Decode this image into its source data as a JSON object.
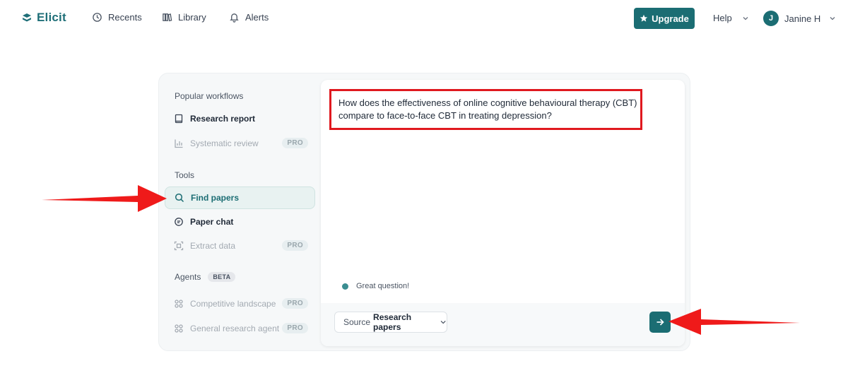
{
  "nav": {
    "brand": "Elicit",
    "recents": "Recents",
    "library": "Library",
    "alerts": "Alerts",
    "upgrade": "Upgrade",
    "help": "Help",
    "user_name": "Janine H",
    "user_initial": "J"
  },
  "sidebar": {
    "popular_title": "Popular workflows",
    "tools_title": "Tools",
    "agents_title": "Agents",
    "agents_badge": "BETA",
    "items": [
      {
        "label": "Research report",
        "icon": "book-icon"
      },
      {
        "label": "Systematic review",
        "icon": "chart-icon",
        "badge": "PRO"
      },
      {
        "label": "Find papers",
        "icon": "search-icon",
        "active": true
      },
      {
        "label": "Paper chat",
        "icon": "chat-icon"
      },
      {
        "label": "Extract data",
        "icon": "extract-icon",
        "badge": "PRO"
      },
      {
        "label": "Competitive landscape",
        "icon": "agent-icon",
        "badge": "PRO"
      },
      {
        "label": "General research agent",
        "icon": "agent-icon",
        "badge": "PRO"
      }
    ]
  },
  "query": {
    "text": "How does the effectiveness of online cognitive behavioural therapy (CBT) compare to face-to-face CBT in treating depression?",
    "status": "Great question!",
    "source_label": "Source",
    "source_value": "Research papers"
  },
  "colors": {
    "brand": "#1b6d73",
    "highlight": "#e0191f"
  }
}
